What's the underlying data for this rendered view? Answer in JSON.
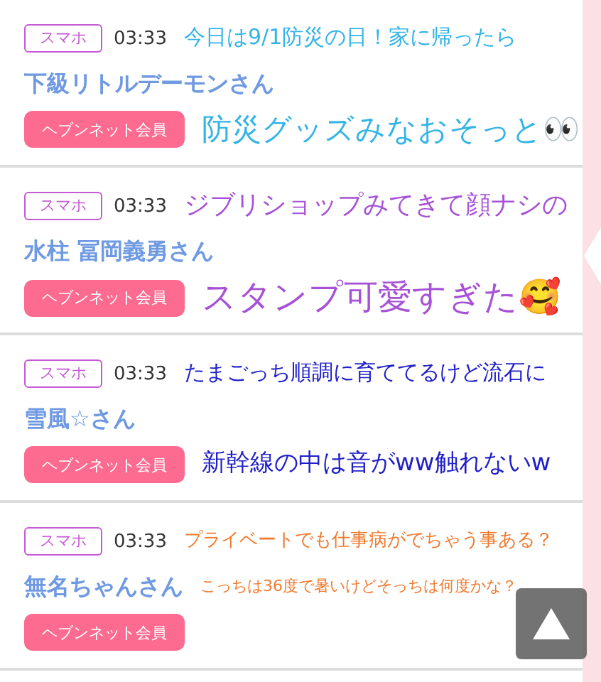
{
  "posts": [
    {
      "device": "スマホ",
      "time": "03:33",
      "name": "下級リトルデーモンさん",
      "member_badge": "ヘブンネット会員",
      "caption": {
        "color": "#33b4e6",
        "lines": [
          "今日は9/1防災の日！家に帰ったら",
          "防災グッズみなおそっと👀"
        ]
      }
    },
    {
      "device": "スマホ",
      "time": "03:33",
      "name": "水柱 冨岡義勇さん",
      "member_badge": "ヘブンネット会員",
      "caption": {
        "color": "#a752d6",
        "lines": [
          "ジブリショップみてきて顔ナシの",
          "スタンプ可愛すぎた🥰"
        ]
      }
    },
    {
      "device": "スマホ",
      "time": "03:33",
      "name": "雪風☆さん",
      "member_badge": "ヘブンネット会員",
      "caption": {
        "color": "#2020c8",
        "lines": [
          "たまごっち順調に育ててるけど流石に",
          "新幹線の中は音がww触れないw"
        ]
      }
    },
    {
      "device": "スマホ",
      "time": "03:33",
      "name": "無名ちゃんさん",
      "member_badge": "ヘブンネット会員",
      "caption": {
        "color": "#f07a2e",
        "lines": [
          "プライベートでも仕事病がでちゃう事ある？",
          "こっちは36度で暑いけどそっちは何度かな？"
        ]
      }
    }
  ]
}
